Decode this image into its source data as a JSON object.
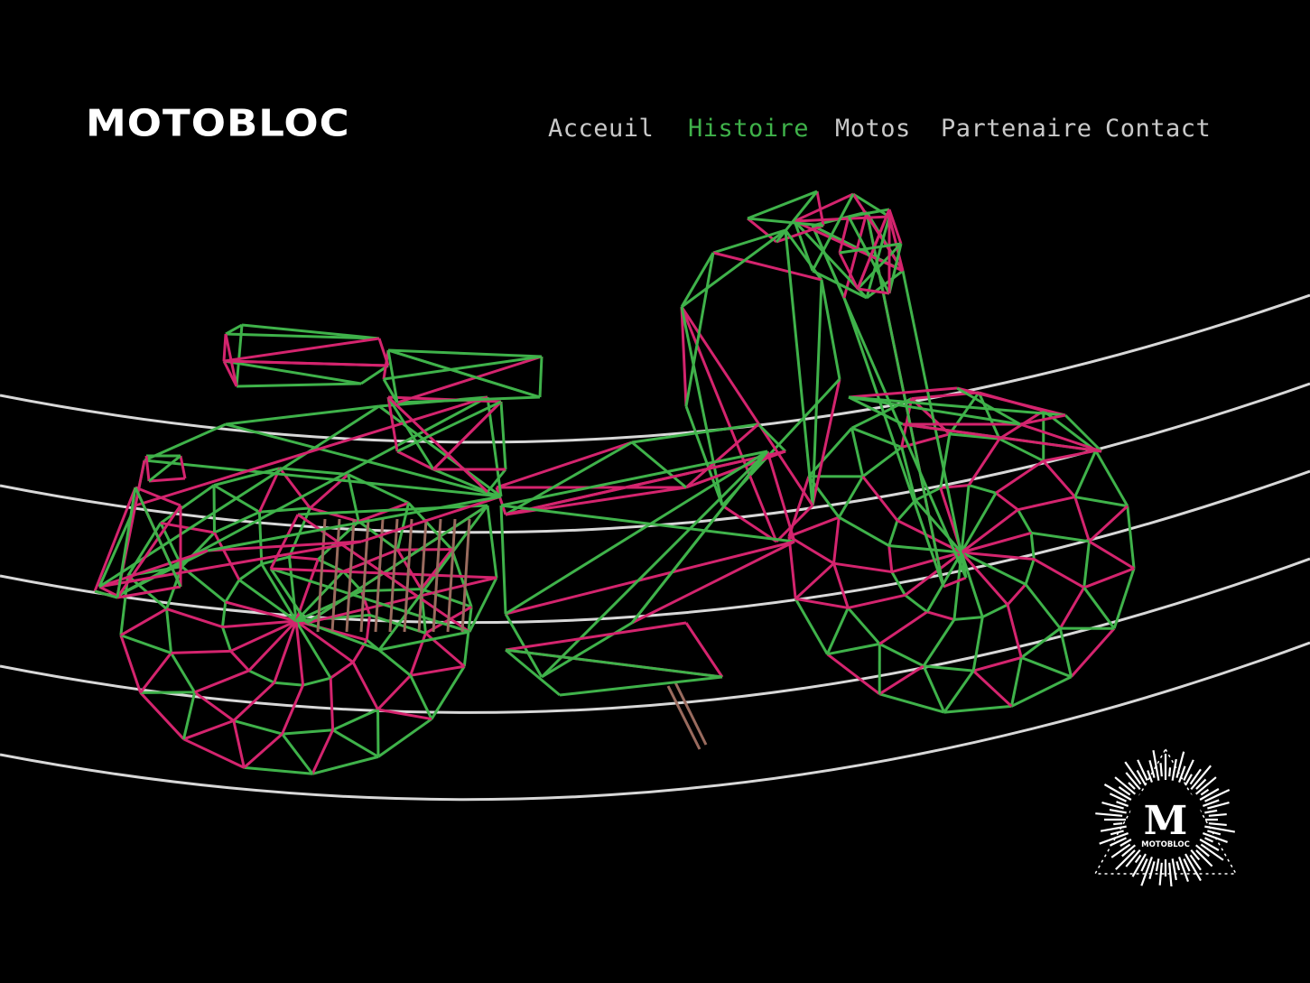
{
  "header": {
    "brand": "MOTOBLOC",
    "nav": [
      {
        "label": "Acceuil",
        "active": false
      },
      {
        "label": "Histoire",
        "active": true
      },
      {
        "label": "Motos",
        "active": false
      },
      {
        "label": "Partenaire",
        "active": false
      },
      {
        "label": "Contact",
        "active": false
      }
    ]
  },
  "badge": {
    "letter": "M",
    "label": "MOTOBLOC"
  },
  "colors": {
    "background": "#000000",
    "accent_green": "#3fb24a",
    "accent_pink": "#d4246e",
    "nav_text": "#c9c9c9",
    "road_lines": "#d8d8d8"
  },
  "icons": [
    "wireframe-motorcycle-illustration",
    "motobloc-badge-icon"
  ]
}
